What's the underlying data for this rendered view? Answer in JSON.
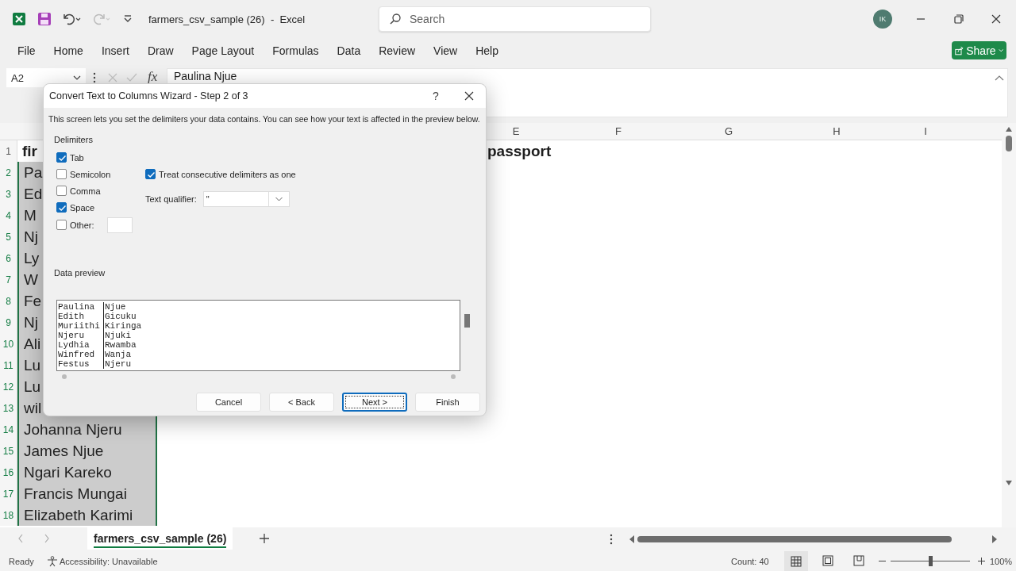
{
  "title_bar": {
    "title": "farmers_csv_sample (26)  -  Excel",
    "search_placeholder": "Search",
    "avatar": "IK"
  },
  "ribbon_tabs": [
    "File",
    "Home",
    "Insert",
    "Draw",
    "Page Layout",
    "Formulas",
    "Data",
    "Review",
    "View",
    "Help"
  ],
  "share": "Share",
  "formula_bar": {
    "name_box": "A2",
    "fx": "fx",
    "formula": "Paulina Njue"
  },
  "grid": {
    "column_headers": [
      "E",
      "F",
      "G",
      "H",
      "I"
    ],
    "rows": [
      {
        "number": "1",
        "kind": "header",
        "selected": false,
        "col_a": "fir",
        "col_e": "passport"
      },
      {
        "number": "2",
        "kind": "data",
        "selected": true,
        "col_a": "Pa"
      },
      {
        "number": "3",
        "kind": "data",
        "selected": true,
        "col_a": "Ed"
      },
      {
        "number": "4",
        "kind": "data",
        "selected": true,
        "col_a": "M"
      },
      {
        "number": "5",
        "kind": "data",
        "selected": true,
        "col_a": "Nj"
      },
      {
        "number": "6",
        "kind": "data",
        "selected": true,
        "col_a": "Ly"
      },
      {
        "number": "7",
        "kind": "data",
        "selected": true,
        "col_a": "W"
      },
      {
        "number": "8",
        "kind": "data",
        "selected": true,
        "col_a": "Fe"
      },
      {
        "number": "9",
        "kind": "data",
        "selected": true,
        "col_a": "Nj"
      },
      {
        "number": "10",
        "kind": "data",
        "selected": true,
        "col_a": "Ali"
      },
      {
        "number": "11",
        "kind": "data",
        "selected": true,
        "col_a": "Lu"
      },
      {
        "number": "12",
        "kind": "data",
        "selected": true,
        "col_a": "Lu"
      },
      {
        "number": "13",
        "kind": "data",
        "selected": true,
        "col_a": "wil"
      },
      {
        "number": "14",
        "kind": "data",
        "selected": true,
        "col_a": "Johanna Njeru"
      },
      {
        "number": "15",
        "kind": "data",
        "selected": true,
        "col_a": "James Njue"
      },
      {
        "number": "16",
        "kind": "data",
        "selected": true,
        "col_a": "Ngari Kareko"
      },
      {
        "number": "17",
        "kind": "data",
        "selected": true,
        "col_a": "Francis Mungai"
      },
      {
        "number": "18",
        "kind": "data",
        "selected": true,
        "col_a": "Elizabeth Karimi"
      }
    ]
  },
  "dialog": {
    "title": "Convert Text to Columns Wizard - Step 2 of 3",
    "help": "?",
    "description": "This screen lets you set the delimiters your data contains.  You can see how your text is affected in the preview below.",
    "delimiters_label": "Delimiters",
    "delimiters": [
      {
        "label": "Tab",
        "checked": true
      },
      {
        "label": "Semicolon",
        "checked": false
      },
      {
        "label": "Comma",
        "checked": false
      },
      {
        "label": "Space",
        "checked": true
      }
    ],
    "other": {
      "label": "Other:",
      "checked": false
    },
    "consecutive": {
      "label": "Treat consecutive delimiters as one",
      "checked": true
    },
    "text_qualifier": {
      "label": "Text qualifier:",
      "value": "\""
    },
    "preview_label": "Data preview",
    "preview_rows": [
      [
        "Paulina",
        "Njue"
      ],
      [
        "Edith",
        "Gicuku"
      ],
      [
        "Muriithi",
        "Kiringa"
      ],
      [
        "Njeru",
        "Njuki"
      ],
      [
        "Lydhia",
        "Rwamba"
      ],
      [
        "Winfred",
        "Wanja"
      ],
      [
        "Festus",
        "Njeru"
      ]
    ],
    "buttons": [
      {
        "label": "Cancel",
        "default": false
      },
      {
        "label": "< Back",
        "default": false
      },
      {
        "label": "Next >",
        "default": true
      },
      {
        "label": "Finish",
        "default": false
      }
    ]
  },
  "sheet_tabs": [
    {
      "label": "farmers_csv_sample (26)",
      "selected": true
    }
  ],
  "status_bar": {
    "ready": "Ready",
    "accessibility": "Accessibility: Unavailable",
    "count": "Count: 40",
    "zoom": "100%"
  },
  "zoom_slider": {
    "level": 0.5
  }
}
